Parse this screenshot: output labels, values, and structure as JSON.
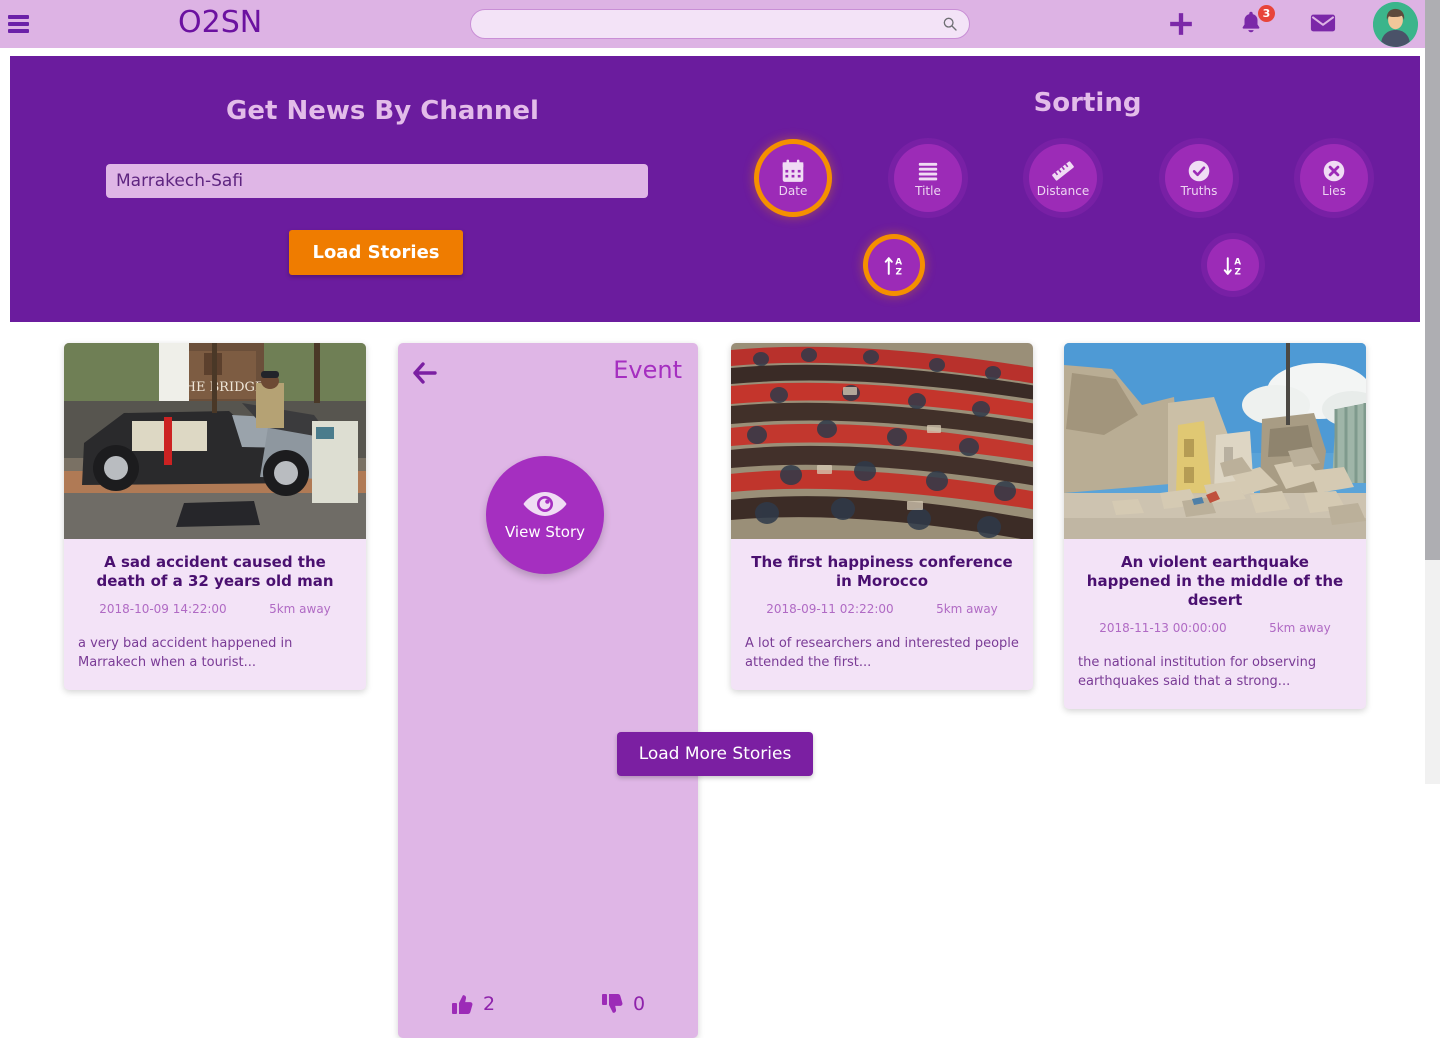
{
  "topbar": {
    "menu_icon": "hamburger-menu-icon",
    "brand": "O2SN",
    "search": {
      "value": "",
      "placeholder": ""
    },
    "search_icon": "search-icon",
    "add_icon": "plus-icon",
    "notifications_icon": "bell-icon",
    "notifications_count": "3",
    "messages_icon": "envelope-icon",
    "avatar": "user-avatar",
    "bg_color": "#ddb3e4",
    "brand_color": "#6b11a0",
    "badge_color": "#e8443a"
  },
  "panel": {
    "bg_color": "#6b1c9e",
    "channel": {
      "title": "Get News By Channel",
      "input_value": "Marrakech-Safi",
      "input_placeholder": "",
      "button_label": "Load Stories",
      "button_color": "#ef7c00"
    },
    "sorting": {
      "title": "Sorting",
      "active_color": "#f59000",
      "options": [
        {
          "label": "Date",
          "icon": "calendar-icon",
          "active": true
        },
        {
          "label": "Title",
          "icon": "list-lines-icon",
          "active": false
        },
        {
          "label": "Distance",
          "icon": "ruler-icon",
          "active": false
        },
        {
          "label": "Truths",
          "icon": "check-circle-icon",
          "active": false
        },
        {
          "label": "Lies",
          "icon": "x-circle-icon",
          "active": false
        }
      ],
      "directions": [
        {
          "label": "Sort Ascending",
          "icon": "sort-alpha-up-icon",
          "active": true
        },
        {
          "label": "Sort Descending",
          "icon": "sort-alpha-down-icon",
          "active": false
        }
      ]
    }
  },
  "cards": [
    {
      "title": "A sad accident caused the death of a 32 years old man",
      "date": "2018-10-09 14:22:00",
      "distance": "5km away",
      "description": "a very bad accident happened in Marrakech when a tourist...",
      "image": "car-accident-photo"
    },
    {
      "title": "The first happiness conference in Morocco",
      "date": "2018-09-11 02:22:00",
      "distance": "5km away",
      "description": "A lot of researchers and interested people attended the first...",
      "image": "conference-auditorium-photo"
    },
    {
      "title": "An violent earthquake happened in the middle of the desert",
      "date": "2018-11-13 00:00:00",
      "distance": "5km away",
      "description": "the national institution for observing earthquakes said that a strong...",
      "image": "earthquake-rubble-photo"
    }
  ],
  "event_card": {
    "back_icon": "arrow-left-icon",
    "label": "Event",
    "view_story_icon": "eye-icon",
    "view_story_label": "View Story",
    "likes_icon": "thumbs-up-icon",
    "likes": "2",
    "dislikes_icon": "thumbs-down-icon",
    "dislikes": "0"
  },
  "footer": {
    "load_more_label": "Load More Stories",
    "button_color": "#7b1fa2"
  }
}
